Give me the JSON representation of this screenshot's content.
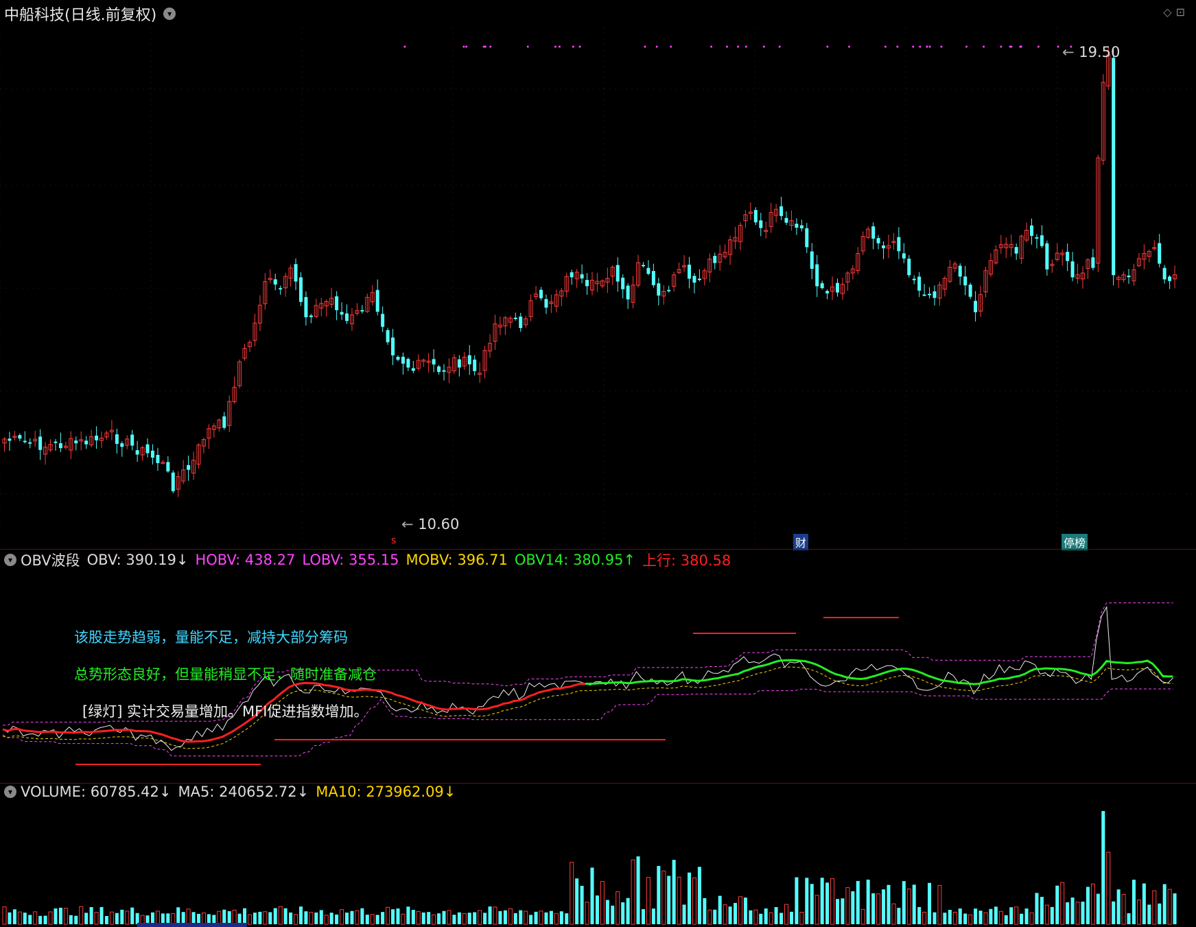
{
  "header": {
    "title": "中船科技(日线.前复权)",
    "dropdown_icon": "chevron-down-icon",
    "corner_icons": [
      "◇",
      "⊡"
    ]
  },
  "price_panel": {
    "high_label": "19.50",
    "low_label": "10.60",
    "markers": {
      "s": "s",
      "finance": "财",
      "limit": "停榜"
    }
  },
  "obv_panel": {
    "name": "OBV波段",
    "obv": "OBV: 390.19↓",
    "hobv": "HOBV: 438.27",
    "lobv": "LOBV: 355.15",
    "mobv": "MOBV: 396.71",
    "obv14": "OBV14: 380.95↑",
    "trend": "上行: 380.58",
    "note1": "该股走势趋弱，量能不足，减持大部分筹码",
    "note2": "总势形态良好，但量能稍显不足，随时准备减仓",
    "note3": "[绿灯] 实计交易量增加。MFI促进指数增加。"
  },
  "volume_panel": {
    "volume": "VOLUME: 60785.42↓",
    "ma5": "MA5: 240652.72↓",
    "ma10": "MA10: 273962.09↓"
  },
  "colors": {
    "up": "#ff3c3c",
    "down": "#54ffff",
    "magenta": "#ff44ff",
    "yellow": "#ffd400",
    "green": "#22ee22",
    "red": "#ff2020",
    "white": "#eeeeee"
  }
}
